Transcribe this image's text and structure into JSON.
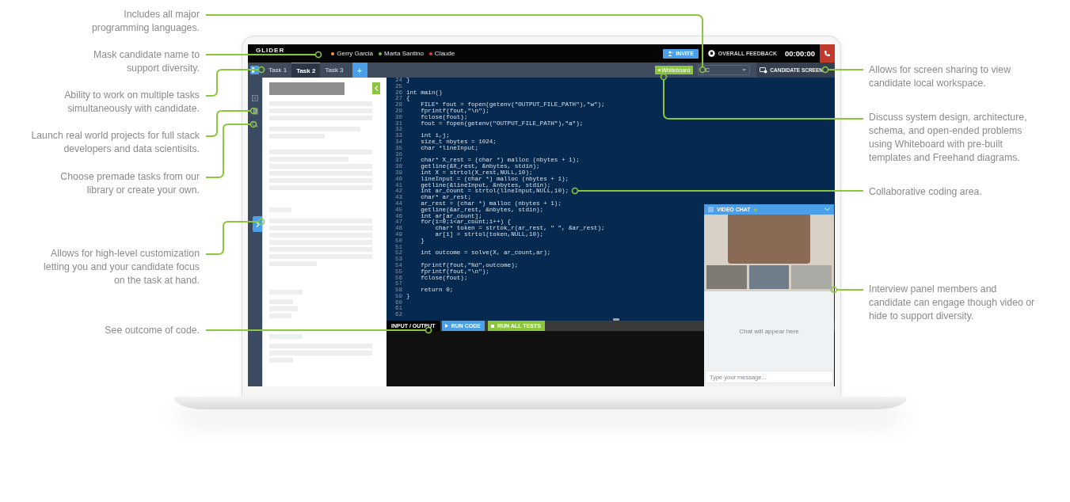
{
  "annotations": [
    {
      "text": "Includes all major\nprogramming languages."
    },
    {
      "text": "Mask candidate name to\nsupport diversity."
    },
    {
      "text": "Ability to work on multiple tasks\nsimultaneously with candidate."
    },
    {
      "text": "Launch real world projects for full stack\ndevelopers and data scientisits."
    },
    {
      "text": "Choose premade tasks from our\nlibrary or create your own."
    },
    {
      "text": "Allows for high-level customization\nletting you and your candidate focus\non the task at hand."
    },
    {
      "text": "See outcome of code."
    },
    {
      "text": "Allows for screen sharing to view\ncandidate local workspace."
    },
    {
      "text": "Discuss system design, architecture,\nschema, and open-ended problems\nusing Whiteboard with pre-built\ntemplates and Freehand diagrams."
    },
    {
      "text": "Collaborative coding area."
    },
    {
      "text": "Interview panel members and\ncandidate can engage though video or\nhide to support diversity."
    }
  ],
  "app": {
    "logo": "GLIDER",
    "participants": [
      {
        "name": "Gerry Garcia",
        "color": "#f0a030"
      },
      {
        "name": "Marta Santino",
        "color": "#7cc242"
      },
      {
        "name": "Claude",
        "color": "#e0413a"
      }
    ],
    "invite_button": "INVITE",
    "feedback_button": "OVERALL FEEDBACK",
    "timer": "00:00:00",
    "tabs": [
      {
        "label": "Task 1",
        "selected": false
      },
      {
        "label": "Task 2",
        "selected": true
      },
      {
        "label": "Task 3",
        "selected": false
      }
    ],
    "add_tab_button": "+",
    "whiteboard_button": "Whiteboard",
    "language_select": {
      "value": "C"
    },
    "candidate_screen_button": "CANDIDATE SCREEN",
    "code_lines": [
      {
        "n": "24",
        "text": "}"
      },
      {
        "n": "25"
      },
      {
        "n": "26",
        "text": "int main()"
      },
      {
        "n": "27",
        "text": "{"
      },
      {
        "n": "28",
        "text": "    FILE* fout = fopen(getenv(\"OUTPUT_FILE_PATH\"),\"w\");"
      },
      {
        "n": "29",
        "text": "    fprintf(fout,\"\\n\");"
      },
      {
        "n": "30",
        "text": "    fclose(fout);"
      },
      {
        "n": "31",
        "text": "    fout = fopen(getenv(\"OUTPUT_FILE_PATH\"),\"a\");"
      },
      {
        "n": "32"
      },
      {
        "n": "33",
        "text": "    int i,j;"
      },
      {
        "n": "34",
        "text": "    size_t nbytes = 1024;"
      },
      {
        "n": "35",
        "text": "    char *lineInput;"
      },
      {
        "n": "36"
      },
      {
        "n": "37",
        "text": "    char* X_rest = (char *) malloc (nbytes + 1);"
      },
      {
        "n": "38",
        "text": "    getline(&X_rest, &nbytes, stdin);"
      },
      {
        "n": "39",
        "text": "    int X = strtol(X_rest,NULL,10);"
      },
      {
        "n": "40",
        "text": "    lineInput = (char *) malloc (nbytes + 1);"
      },
      {
        "n": "41",
        "text": "    getline(&lineInput, &nbytes, stdin);"
      },
      {
        "n": "42",
        "text": "    int ar_count = strtol(lineInput,NULL,10);"
      },
      {
        "n": "43",
        "text": "    char* ar_rest;"
      },
      {
        "n": "44",
        "text": "    ar_rest = (char *) malloc (nbytes + 1);"
      },
      {
        "n": "45",
        "text": "    getline(&ar_rest, &nbytes, stdin);"
      },
      {
        "n": "46",
        "text": "    int ar[ar_count];"
      },
      {
        "n": "47",
        "text": "    for(i=0;i<ar_count;i++) {"
      },
      {
        "n": "48",
        "text": "        char* token = strtok_r(ar_rest, \" \", &ar_rest);"
      },
      {
        "n": "49",
        "text": "        ar[i] = strtol(token,NULL,10);"
      },
      {
        "n": "50",
        "text": "    }"
      },
      {
        "n": "51"
      },
      {
        "n": "52",
        "text": "    int outcome = solve(X, ar_count,ar);"
      },
      {
        "n": "53"
      },
      {
        "n": "54",
        "text": "    fprintf(fout,\"%d\",outcome);"
      },
      {
        "n": "55",
        "text": "    fprintf(fout,\"\\n\");"
      },
      {
        "n": "56",
        "text": "    fclose(fout);"
      },
      {
        "n": "57"
      },
      {
        "n": "58",
        "text": "    return 0;"
      },
      {
        "n": "59",
        "text": "}"
      },
      {
        "n": "60"
      },
      {
        "n": "61"
      },
      {
        "n": "62"
      }
    ],
    "io_label": "INPUT / OUTPUT",
    "run_code_button": "RUN CODE",
    "run_tests_button": "RUN ALL TESTS",
    "video_chat": {
      "title": "VIDEO CHAT",
      "chat_empty_text": "Chat will appear here",
      "message_input": {
        "placeholder": "Type your message..."
      }
    }
  }
}
